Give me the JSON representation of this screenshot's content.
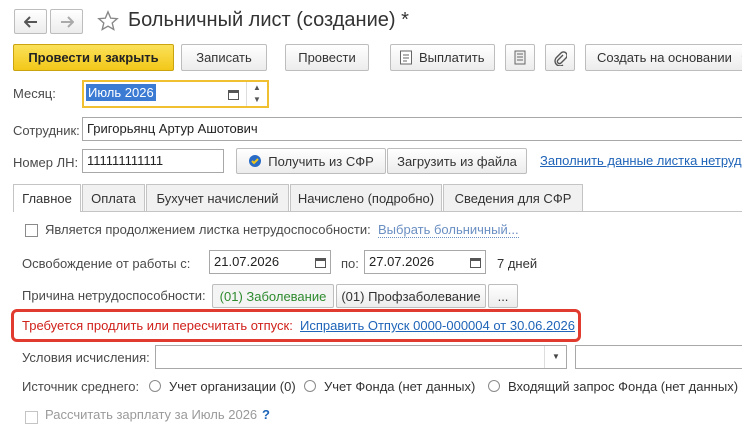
{
  "header": {
    "title": "Больничный лист (создание) *",
    "back_icon": "arrow-left-icon",
    "forward_icon": "arrow-right-icon",
    "star_icon": "star-outline-icon"
  },
  "toolbar": {
    "post_close_label": "Провести и закрыть",
    "save_label": "Записать",
    "post_label": "Провести",
    "pay_label": "Выплатить",
    "create_based_label": "Создать на основании"
  },
  "form": {
    "month_label": "Месяц:",
    "month_value": "Июль 2026",
    "employee_label": "Сотрудник:",
    "employee_value": "Григорьянц Артур Ашотович",
    "ln_label": "Номер ЛН:",
    "ln_value": "111111111111",
    "get_sfr_label": "Получить из СФР",
    "load_file_label": "Загрузить из файла",
    "fill_link": "Заполнить данные листка нетрудо"
  },
  "tabs": [
    {
      "label": "Главное"
    },
    {
      "label": "Оплата"
    },
    {
      "label": "Бухучет начислений"
    },
    {
      "label": "Начислено (подробно)"
    },
    {
      "label": "Сведения для СФР"
    }
  ],
  "main": {
    "continuation_label": "Является продолжением листка нетрудоспособности:",
    "choose_sick_link": "Выбрать больничный...",
    "release_label": "Освобождение от работы с:",
    "date_from": "21.07.2026",
    "to_label": "по:",
    "date_to": "27.07.2026",
    "days_label": "7 дней",
    "reason_label": "Причина нетрудоспособности:",
    "reason_disease": "(01) Заболевание",
    "reason_occupational": "(01) Профзаболевание",
    "reason_more": "...",
    "warning_text": "Требуется продлить или пересчитать отпуск:",
    "warning_link": "Исправить Отпуск 0000-000004 от 30.06.2026",
    "calc_conditions_label": "Условия исчисления:",
    "avg_source_label": "Источник среднего:",
    "source_org": "Учет организации (0)",
    "source_fund": "Учет Фонда (нет данных)",
    "source_incoming": "Входящий запрос Фонда (нет данных)",
    "calc_salary_label": "Рассчитать зарплату за Июль 2026",
    "help_mark": "?"
  },
  "colors": {
    "primary_button": "#f2c818",
    "link": "#1f64b8",
    "warning_text": "#d0201a",
    "highlight_border": "#e03b2e",
    "active_field_border": "#f0c030",
    "selection": "#3b7bd4",
    "green_text": "#2e8b2e"
  }
}
